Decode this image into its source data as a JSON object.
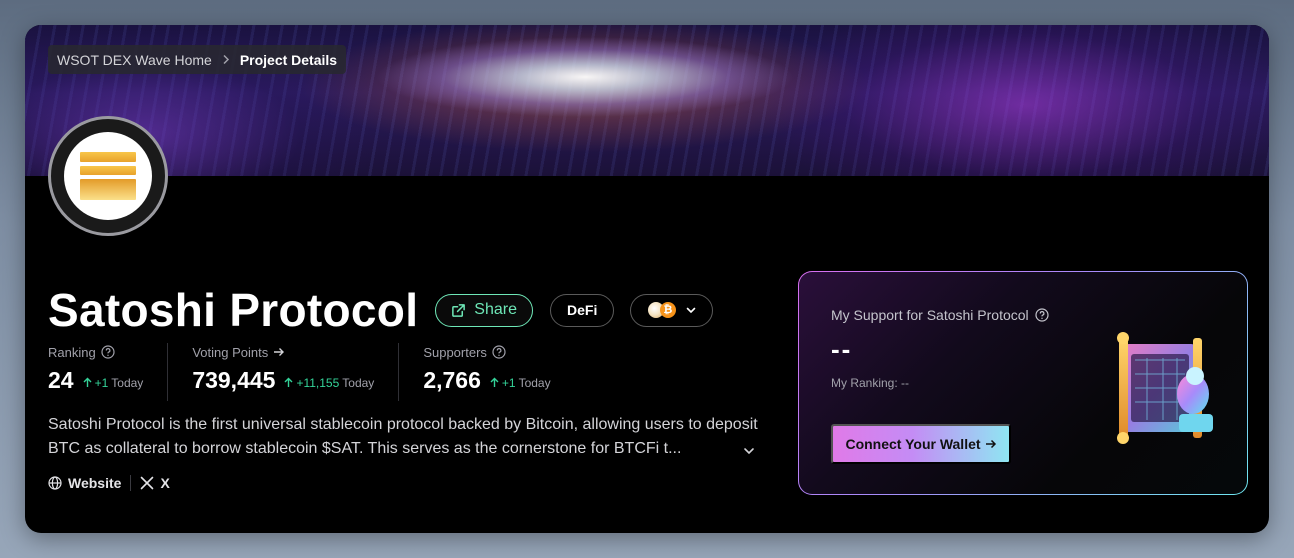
{
  "breadcrumb": {
    "home": "WSOT DEX Wave Home",
    "separator": ">",
    "current": "Project Details"
  },
  "project": {
    "name": "Satoshi Protocol",
    "share_label": "Share",
    "category": "DeFi",
    "description": "Satoshi Protocol is the first universal stablecoin protocol backed by Bitcoin, allowing users to deposit BTC as collateral to borrow stablecoin $SAT. This serves as the cornerstone for BTCFi t..."
  },
  "stats": [
    {
      "label": "Ranking",
      "value": "24",
      "delta": "+1",
      "period": "Today"
    },
    {
      "label": "Voting Points",
      "value": "739,445",
      "delta": "+11,155",
      "period": "Today"
    },
    {
      "label": "Supporters",
      "value": "2,766",
      "delta": "+1",
      "period": "Today"
    }
  ],
  "links": {
    "website": "Website",
    "x": "X"
  },
  "support": {
    "title": "My Support for Satoshi Protocol",
    "value": "--",
    "ranking": "My Ranking: --",
    "connect_label": "Connect Your Wallet"
  },
  "colors": {
    "accent_green": "#34d399",
    "share_border": "#6ee7b7",
    "btc_orange": "#f7931a"
  },
  "icons": [
    "external-link-icon",
    "chevron-down-icon",
    "question-circle-icon",
    "arrow-up-icon",
    "arrow-right-icon",
    "globe-icon",
    "x-logo-icon"
  ]
}
